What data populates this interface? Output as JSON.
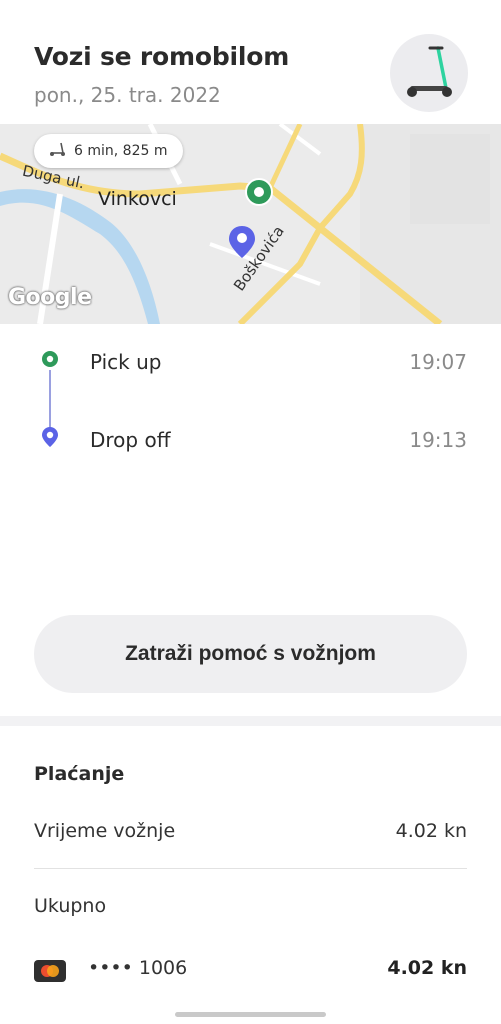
{
  "header": {
    "title": "Vozi se romobilom",
    "date": "pon., 25. tra. 2022",
    "avatar_icon": "scooter-icon"
  },
  "map": {
    "chip_text": "6 min, 825 m",
    "chip_icon": "scooter-small-icon",
    "labels": {
      "street": "Duga ul.",
      "city": "Vinkovci",
      "road": "Boškovića"
    },
    "attribution": "Google",
    "colors": {
      "pickup": "#2e9a5a",
      "dropoff": "#5b63e6",
      "road": "#f6d97a",
      "river": "#b6d7f0"
    }
  },
  "timeline": {
    "pickup": {
      "label": "Pick up",
      "time": "19:07"
    },
    "dropoff": {
      "label": "Drop off",
      "time": "19:13"
    }
  },
  "help_button": "Zatraži pomoć s vožnjom",
  "payment": {
    "title": "Plaćanje",
    "ride_time_label": "Vrijeme vožnje",
    "ride_time_value": "4.02 kn",
    "total_label": "Ukupno",
    "card_masked": "•••• 1006",
    "total_value": "4.02 kn",
    "card_icon": "mastercard-icon"
  }
}
